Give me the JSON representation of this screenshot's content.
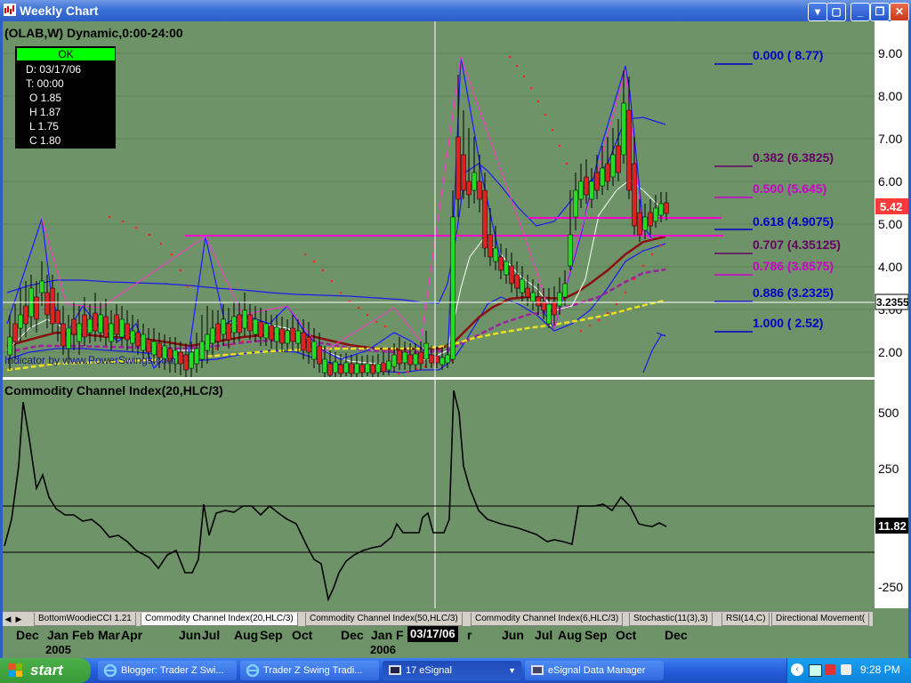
{
  "window": {
    "title": "Weekly Chart"
  },
  "chart": {
    "symbol_line": "(OLAB,W) Dynamic,0:00-24:00",
    "cursor_box": {
      "status": "OK",
      "rows": [
        "D: 03/17/06",
        "T: 00:00",
        "O  1.85",
        "H  1.87",
        "L  1.75",
        "C  1.80"
      ]
    },
    "price_labels": [
      "9.00",
      "8.00",
      "7.00",
      "6.00",
      "5.00",
      "4.00",
      "3.00",
      "2.00"
    ],
    "current_price": "5.42",
    "crosshair_price": "3.2355",
    "indicator_credit": "Indicator by www.PowerSwings.com",
    "fib_levels": [
      {
        "label": "0.000 ( 8.77)",
        "color": "#0000cc"
      },
      {
        "label": "0.382 (6.3825)",
        "color": "#660066"
      },
      {
        "label": "0.500 (5.645)",
        "color": "#cc00cc"
      },
      {
        "label": "0.618 (4.9075)",
        "color": "#0000cc"
      },
      {
        "label": "0.707 (4.35125)",
        "color": "#660066"
      },
      {
        "label": "0.786 (3.8575)",
        "color": "#cc00cc"
      },
      {
        "label": "0.886 (3.2325)",
        "color": "#0000cc"
      },
      {
        "label": "1.000 ( 2.52)",
        "color": "#0000cc"
      }
    ],
    "cci_title": "Commodity Channel Index(20,HLC/3)",
    "cci_labels": [
      "500",
      "250",
      "-250"
    ],
    "cci_current": "11.82"
  },
  "tabs": [
    "BottomWoodieCCI 1.21",
    "Commodity Channel Index(20,HLC/3)",
    "Commodity Channel Index(50,HLC/3)",
    "Commodity Channel Index(6,HLC/3)",
    "Stochastic(11(3),3)",
    "RSI(14,C)",
    "Directional Movement("
  ],
  "xaxis": {
    "months": [
      "Dec",
      "Jan",
      "Feb",
      "Mar",
      "Apr",
      "Jun",
      "Jul",
      "Aug",
      "Sep",
      "Oct",
      "Dec",
      "Jan",
      "F",
      "r",
      "Jun",
      "Jul",
      "Aug",
      "Sep",
      "Oct",
      "Dec"
    ],
    "years": [
      "2005",
      "2006"
    ],
    "crosshair_date": "03/17/06"
  },
  "taskbar": {
    "start": "start",
    "items": [
      "Blogger: Trader Z Swi...",
      "Trader Z Swing Tradi...",
      "17 eSignal",
      "eSignal Data Manager"
    ],
    "clock": "9:28 PM"
  }
}
